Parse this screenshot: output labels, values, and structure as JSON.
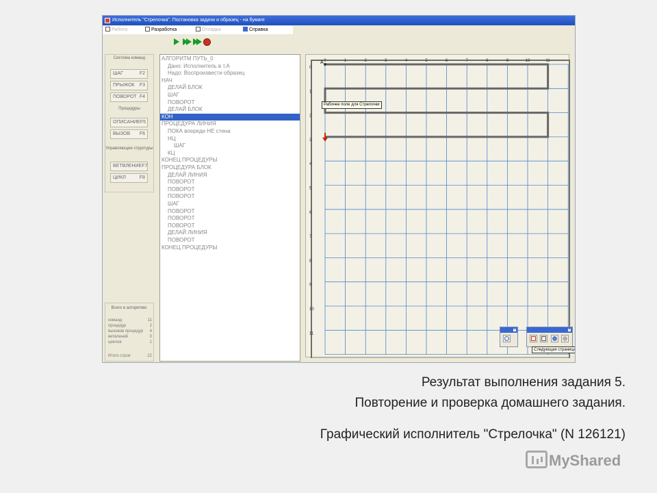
{
  "window": {
    "title": "Исполнитель \"Стрелочка\". Постановка задачи и образец - на бумаге"
  },
  "menu": {
    "items": [
      {
        "label": "Работа",
        "enabled": false
      },
      {
        "label": "Разработка",
        "enabled": true
      },
      {
        "label": "Отладка",
        "enabled": false
      },
      {
        "label": "Справка",
        "enabled": true
      }
    ]
  },
  "toolbar": {
    "icons": [
      "run-icon",
      "run-steps-icon",
      "run-fast-icon",
      "stop-icon"
    ],
    "colors": {
      "run": "#1b9a2c",
      "stop": "#d03020"
    }
  },
  "commands": {
    "caption": "Система команд",
    "buttons": [
      {
        "label": "ШАГ",
        "key": "F2"
      },
      {
        "label": "ПРЫЖОК",
        "key": "F3"
      },
      {
        "label": "ПОВОРОТ",
        "key": "F4"
      }
    ],
    "procedures_caption": "Процедуры",
    "procedure_buttons": [
      {
        "label": "ОПИСАНИЕ",
        "key": "F5"
      },
      {
        "label": "ВЫЗОВ",
        "key": "F6"
      }
    ],
    "control_caption": "Управляющие структуры",
    "control_buttons": [
      {
        "label": "ВЕТВЛЕНИЕ",
        "key": "F7"
      },
      {
        "label": "ЦИКЛ",
        "key": "F8"
      }
    ]
  },
  "stats": {
    "caption": "Всего в алгоритме:",
    "rows": [
      {
        "label": "команд",
        "value": "11"
      },
      {
        "label": "процедур",
        "value": "2"
      },
      {
        "label": "вызовов процедур",
        "value": "4"
      },
      {
        "label": "ветвлений",
        "value": "0"
      },
      {
        "label": "циклов",
        "value": "1"
      }
    ],
    "total_label": "Итого строк",
    "total_value": "22"
  },
  "editor": {
    "selected_index": 8,
    "lines": [
      {
        "indent": 0,
        "text": "АЛГОРИТМ ПУТЬ_0"
      },
      {
        "indent": 1,
        "text": "Дано: Исполнитель в т.А"
      },
      {
        "indent": 1,
        "text": "Надо: Воспроизвести образец"
      },
      {
        "indent": 0,
        "text": "НАЧ"
      },
      {
        "indent": 1,
        "text": "ДЕЛАЙ БЛОК"
      },
      {
        "indent": 1,
        "text": "ШАГ"
      },
      {
        "indent": 1,
        "text": "ПОВОРОТ"
      },
      {
        "indent": 1,
        "text": "ДЕЛАЙ БЛОК"
      },
      {
        "indent": 0,
        "text": "КОН"
      },
      {
        "indent": 0,
        "text": "ПРОЦЕДУРА ЛИНИЯ"
      },
      {
        "indent": 1,
        "text": "ПОКА впереди НЕ стена"
      },
      {
        "indent": 1,
        "text": "НЦ"
      },
      {
        "indent": 2,
        "text": "ШАГ"
      },
      {
        "indent": 1,
        "text": "КЦ"
      },
      {
        "indent": 0,
        "text": "КОНЕЦ ПРОЦЕДУРЫ"
      },
      {
        "indent": 0,
        "text": "ПРОЦЕДУРА БЛОК"
      },
      {
        "indent": 1,
        "text": "ДЕЛАЙ ЛИНИЯ"
      },
      {
        "indent": 1,
        "text": "ПОВОРОТ"
      },
      {
        "indent": 1,
        "text": "ПОВОРОТ"
      },
      {
        "indent": 1,
        "text": "ПОВОРОТ"
      },
      {
        "indent": 1,
        "text": "ШАГ"
      },
      {
        "indent": 1,
        "text": "ПОВОРОТ"
      },
      {
        "indent": 1,
        "text": "ПОВОРОТ"
      },
      {
        "indent": 1,
        "text": "ПОВОРОТ"
      },
      {
        "indent": 1,
        "text": "ДЕЛАЙ ЛИНИЯ"
      },
      {
        "indent": 1,
        "text": "ПОВОРОТ"
      },
      {
        "indent": 0,
        "text": "КОНЕЦ ПРОЦЕДУРЫ"
      }
    ]
  },
  "field": {
    "columns": [
      "0",
      "1",
      "2",
      "3",
      "4",
      "5",
      "6",
      "7",
      "8",
      "9",
      "10",
      "11"
    ],
    "rows": [
      "0",
      "1",
      "2",
      "3",
      "4",
      "5",
      "6",
      "7",
      "8",
      "9",
      "10",
      "11"
    ],
    "start_label": "А",
    "tooltip": "Рабочее поле для Стрелочки",
    "path": [
      [
        0,
        0
      ],
      [
        11,
        0
      ],
      [
        11,
        1
      ],
      [
        0,
        1
      ],
      [
        0,
        2
      ],
      [
        11,
        2
      ],
      [
        11,
        3
      ],
      [
        0,
        3
      ]
    ],
    "arrow_cell": [
      0,
      3
    ],
    "colors": {
      "grid": "#4f86c8",
      "path": "#666666",
      "arrow": "#cc2200"
    }
  },
  "toolwindows": {
    "next_page_tip": "Следующая страница"
  },
  "slide": {
    "caption_line1": "Результат выполнения задания 5.",
    "caption_line2": "Повторение и проверка домашнего задания.",
    "caption_line3": "Графический исполнитель \"Стрелочка\" (N 126121)",
    "logo_text": "MyShared"
  }
}
